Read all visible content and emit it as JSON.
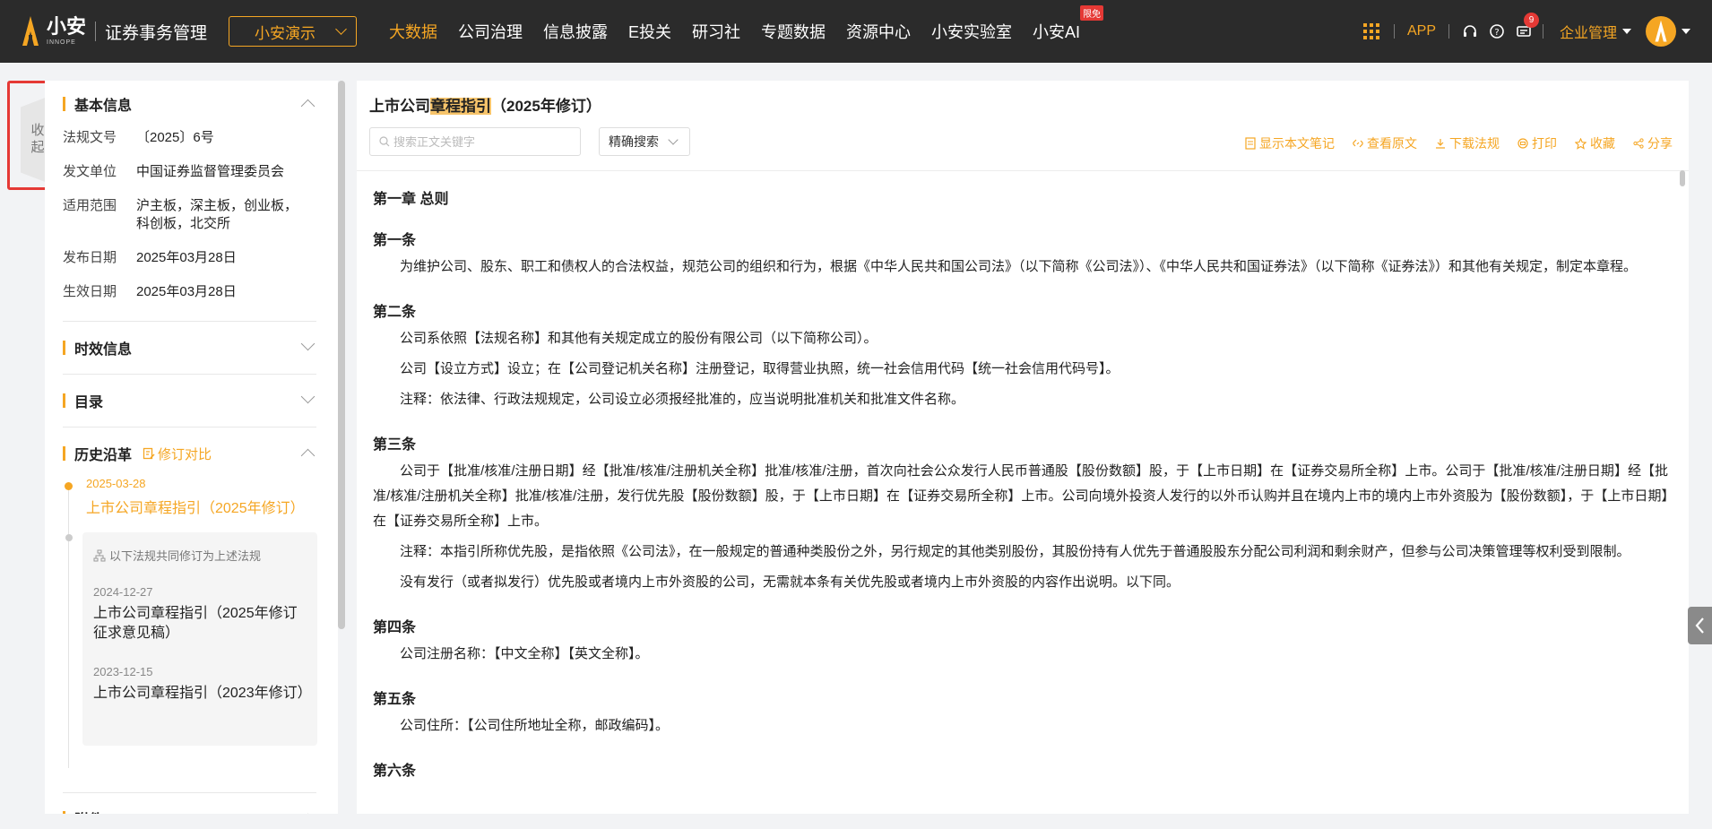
{
  "header": {
    "logo_cn": "小安",
    "logo_en": "INNOPE",
    "system_title": "证券事务管理",
    "demo_select": "小安演示",
    "nav": [
      {
        "label": "大数据",
        "active": true
      },
      {
        "label": "公司治理"
      },
      {
        "label": "信息披露"
      },
      {
        "label": "E投关"
      },
      {
        "label": "研习社"
      },
      {
        "label": "专题数据"
      },
      {
        "label": "资源中心"
      },
      {
        "label": "小安实验室"
      },
      {
        "label": "小安AI",
        "badge": "限免"
      }
    ],
    "app_label": "APP",
    "message_count": "9",
    "enterprise_label": "企业管理",
    "accent_color": "#f5a623"
  },
  "collapse": {
    "label": "收起"
  },
  "left": {
    "basic": {
      "title": "基本信息",
      "rows": [
        {
          "label": "法规文号",
          "value": "〔2025〕6号"
        },
        {
          "label": "发文单位",
          "value": "中国证券监督管理委员会"
        },
        {
          "label": "适用范围",
          "value": "沪主板，深主板，创业板，科创板，北交所"
        },
        {
          "label": "发布日期",
          "value": "2025年03月28日"
        },
        {
          "label": "生效日期",
          "value": "2025年03月28日"
        }
      ]
    },
    "validity_title": "时效信息",
    "toc_title": "目录",
    "history": {
      "title": "历史沿革",
      "compare": "修订对比",
      "current": {
        "date": "2025-03-28",
        "title": "上市公司章程指引（2025年修订）"
      },
      "group_hint": "以下法规共同修订为上述法规",
      "group": [
        {
          "date": "2024-12-27",
          "title": "上市公司章程指引（2025年修订征求意见稿）"
        },
        {
          "date": "2023-12-15",
          "title": "上市公司章程指引（2023年修订）"
        }
      ]
    },
    "attachment_title": "附件"
  },
  "doc": {
    "title_pre": "上市公司",
    "title_hl": "章程指引",
    "title_post": "（2025年修订）",
    "search_placeholder": "搜索正文关键字",
    "precise_label": "精确搜索",
    "actions": [
      "显示本文笔记",
      "查看原文",
      "下载法规",
      "打印",
      "收藏",
      "分享"
    ],
    "chapter": "第一章 总则",
    "articles": [
      {
        "title": "第一条",
        "paras": [
          "为维护公司、股东、职工和债权人的合法权益，规范公司的组织和行为，根据《中华人民共和国公司法》（以下简称《公司法》）、《中华人民共和国证券法》（以下简称《证券法》）和其他有关规定，制定本章程。"
        ]
      },
      {
        "title": "第二条",
        "paras": [
          "公司系依照【法规名称】和其他有关规定成立的股份有限公司（以下简称公司）。",
          "公司【设立方式】设立；在【公司登记机关名称】注册登记，取得营业执照，统一社会信用代码【统一社会信用代码号】。",
          "注释：依法律、行政法规规定，公司设立必须报经批准的，应当说明批准机关和批准文件名称。"
        ]
      },
      {
        "title": "第三条",
        "paras": [
          "公司于【批准/核准/注册日期】经【批准/核准/注册机关全称】批准/核准/注册，首次向社会公众发行人民币普通股【股份数额】股，于【上市日期】在【证券交易所全称】上市。公司于【批准/核准/注册日期】经【批准/核准/注册机关全称】批准/核准/注册，发行优先股【股份数额】股，于【上市日期】在【证券交易所全称】上市。公司向境外投资人发行的以外币认购并且在境内上市的境内上市外资股为【股份数额】，于【上市日期】在【证券交易所全称】上市。",
          "注释：本指引所称优先股，是指依照《公司法》，在一般规定的普通种类股份之外，另行规定的其他类别股份，其股份持有人优先于普通股股东分配公司利润和剩余财产，但参与公司决策管理等权利受到限制。",
          "没有发行（或者拟发行）优先股或者境内上市外资股的公司，无需就本条有关优先股或者境内上市外资股的内容作出说明。以下同。"
        ]
      },
      {
        "title": "第四条",
        "paras": [
          "公司注册名称：【中文全称】【英文全称】。"
        ]
      },
      {
        "title": "第五条",
        "paras": [
          "公司住所：【公司住所地址全称，邮政编码】。"
        ]
      },
      {
        "title": "第六条",
        "paras": []
      }
    ]
  }
}
